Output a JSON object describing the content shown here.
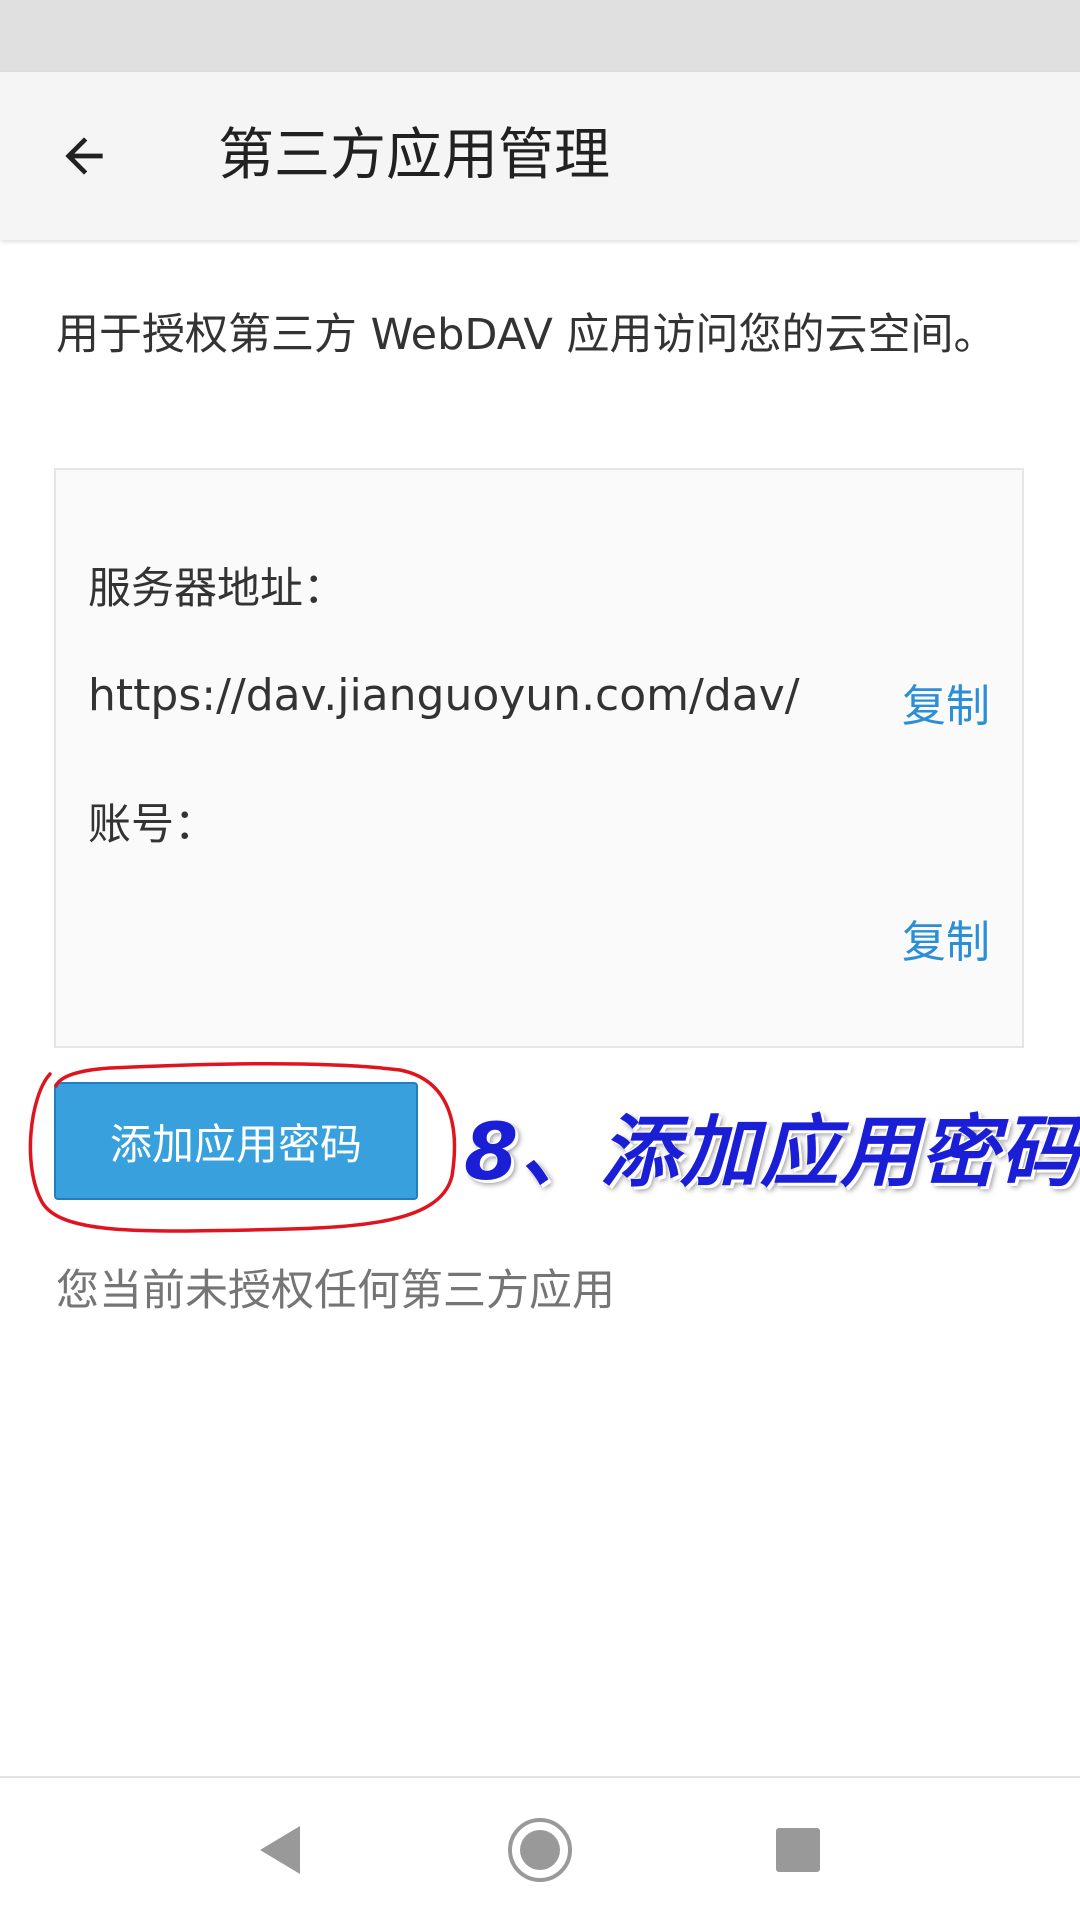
{
  "app_bar": {
    "title": "第三方应用管理",
    "back_icon": "arrow-left-icon"
  },
  "description": "用于授权第三方 WebDAV 应用访问您的云空间。",
  "server_card": {
    "server_label": "服务器地址：",
    "server_url": "https://dav.jianguoyun.com/dav/",
    "copy_label": "复制",
    "account_label": "账号：",
    "account_value": "",
    "account_copy_label": "复制"
  },
  "add_button_label": "添加应用密码",
  "annotation": {
    "text": "8、添加应用密码",
    "text_color": "#1a1fd6",
    "circle_color": "#e0141e"
  },
  "empty_message": "您当前未授权任何第三方应用",
  "colors": {
    "accent": "#38a1dd",
    "link": "#2b8fd6"
  },
  "nav_bar": {
    "back_icon": "triangle-back-icon",
    "home_icon": "circle-home-icon",
    "recents_icon": "square-recents-icon"
  }
}
